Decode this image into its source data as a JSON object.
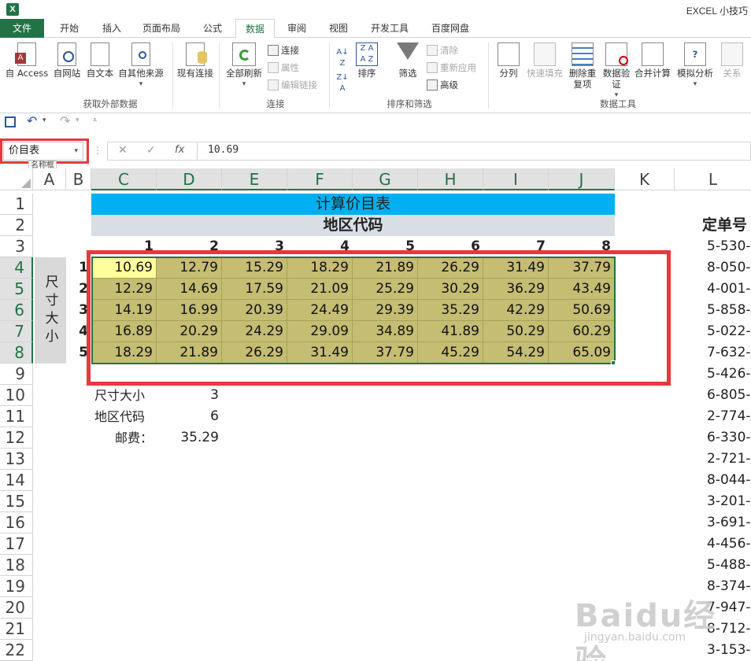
{
  "window": {
    "title": "EXCEL 小技巧",
    "logo": "X"
  },
  "tabs": [
    "文件",
    "开始",
    "插入",
    "页面布局",
    "公式",
    "数据",
    "审阅",
    "视图",
    "开发工具",
    "百度网盘"
  ],
  "ribbon": {
    "groups": [
      {
        "label": "获取外部数据",
        "buttons": [
          "自 Access",
          "自网站",
          "自文本",
          "自其他来源",
          "现有连接"
        ]
      },
      {
        "label": "连接",
        "buttons": [
          "全部刷新"
        ],
        "small": [
          "连接",
          "属性",
          "编辑链接"
        ]
      },
      {
        "label": "排序和筛选",
        "buttons": [
          "排序",
          "筛选"
        ],
        "small": [
          "清除",
          "重新应用",
          "高级"
        ]
      },
      {
        "label": "数据工具",
        "buttons": [
          "分列",
          "快速填充",
          "删除重复项",
          "数据验证",
          "合并计算",
          "模拟分析",
          "关系"
        ]
      }
    ]
  },
  "formula_bar": {
    "name_box": "价目表",
    "name_tooltip": "名称框",
    "value": "10.69"
  },
  "columns": [
    "A",
    "B",
    "C",
    "D",
    "E",
    "F",
    "G",
    "H",
    "I",
    "J",
    "K",
    "L"
  ],
  "rows": [
    "1",
    "2",
    "3",
    "4",
    "5",
    "6",
    "7",
    "8",
    "9",
    "10",
    "11",
    "12",
    "13",
    "14",
    "15",
    "16",
    "17",
    "18",
    "19",
    "20",
    "21",
    "22"
  ],
  "sheet": {
    "title": "计算价目表",
    "region_header": "地区代码",
    "region_codes": [
      "1",
      "2",
      "3",
      "4",
      "5",
      "6",
      "7",
      "8"
    ],
    "size_label": "尺寸大小",
    "size_codes": [
      "1",
      "2",
      "3",
      "4",
      "5"
    ],
    "table": [
      [
        "10.69",
        "12.79",
        "15.29",
        "18.29",
        "21.89",
        "26.29",
        "31.49",
        "37.79"
      ],
      [
        "12.29",
        "14.69",
        "17.59",
        "21.09",
        "25.29",
        "30.29",
        "36.29",
        "43.49"
      ],
      [
        "14.19",
        "16.99",
        "20.39",
        "24.49",
        "29.39",
        "35.29",
        "42.29",
        "50.69"
      ],
      [
        "16.89",
        "20.29",
        "24.29",
        "29.09",
        "34.89",
        "41.89",
        "50.29",
        "60.29"
      ],
      [
        "18.29",
        "21.89",
        "26.29",
        "31.49",
        "37.79",
        "45.29",
        "54.29",
        "65.09"
      ]
    ],
    "lookup": [
      {
        "label": "尺寸大小",
        "value": "3"
      },
      {
        "label": "地区代码",
        "value": "6"
      },
      {
        "label": "邮费：",
        "value": "35.29"
      }
    ],
    "order_header": "定单号",
    "orders": [
      "5-530-",
      "8-050-",
      "4-001-",
      "5-858-",
      "5-022-",
      "7-632-",
      "5-426-",
      "6-805-",
      "2-774-",
      "6-330-",
      "2-721-",
      "8-044-",
      "3-201-",
      "3-691-",
      "4-456-",
      "5-488-",
      "8-374-",
      "7-947-",
      "8-712-",
      "3-153-"
    ]
  },
  "watermark": {
    "main": "Baidu经验",
    "sub": "jingyan.baidu.com"
  },
  "colors": {
    "excel_green": "#217346",
    "title_blue": "#00b0f0",
    "table_olive": "#c4bd72",
    "active_yellow": "#ffff9c",
    "highlight_red": "#e8383d"
  }
}
